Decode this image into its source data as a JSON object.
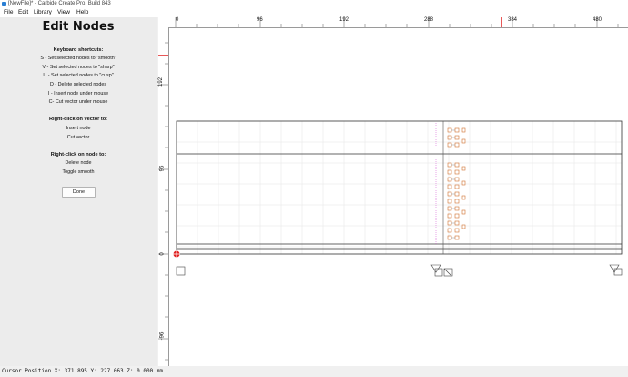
{
  "window": {
    "title": "[NewFile]* - Carbide Create Pro, Build 843",
    "icon": "app-icon"
  },
  "menu": [
    "File",
    "Edit",
    "Library",
    "View",
    "Help"
  ],
  "panel": {
    "title": "Edit Nodes",
    "keyboard_heading": "Keyboard shortcuts:",
    "keyboard_items": [
      "S - Set selected nodes to \"smooth\"",
      "V - Set selected nodes to \"sharp\"",
      "U - Set selected nodes to \"cusp\"",
      "D - Delete selected nodes",
      "I - Insert node under mouse",
      "C- Cut vector under mouse"
    ],
    "vector_heading": "Right-click on vector to:",
    "vector_items": [
      "Insert node",
      "Cut vector"
    ],
    "node_heading": "Right-click on node to:",
    "node_items": [
      "Delete node",
      "Toggle smooth"
    ],
    "done_label": "Done"
  },
  "rulers": {
    "horizontal": [
      "0",
      "96",
      "192",
      "288",
      "384",
      "480"
    ],
    "vertical": [
      "192",
      "96",
      "0",
      "-96"
    ],
    "cursor_marker_color": "#e02020"
  },
  "canvas": {
    "stock_outline": "#333333",
    "grid_color": "#e4e4e4",
    "node_color": "#d07030",
    "handle_color": "#d04ad0",
    "origin_marker_color": "#e02020"
  },
  "status": {
    "cursor_position": "Cursor Position X: 371.895 Y: 227.063 Z: 0.000 mm"
  }
}
